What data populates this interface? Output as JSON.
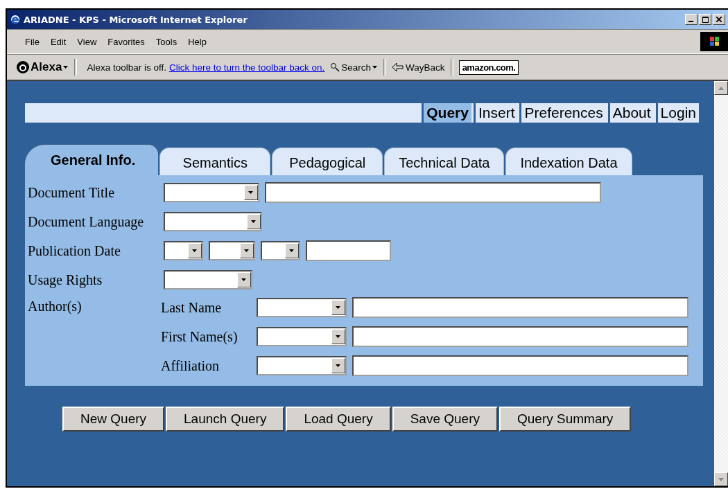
{
  "window": {
    "title": "ARIADNE - KPS - Microsoft Internet Explorer"
  },
  "menu": [
    {
      "label": "File"
    },
    {
      "label": "Edit"
    },
    {
      "label": "View"
    },
    {
      "label": "Favorites"
    },
    {
      "label": "Tools"
    },
    {
      "label": "Help"
    }
  ],
  "toolbar": {
    "alexa": "Alexa",
    "message": "Alexa toolbar is off.",
    "link": "Click here to turn the toolbar back on.",
    "search": "Search",
    "wayback": "WayBack",
    "amazon": "amazon.com."
  },
  "nav": [
    {
      "label": "Query",
      "selected": true
    },
    {
      "label": "Insert",
      "selected": false
    },
    {
      "label": "Preferences",
      "selected": false
    },
    {
      "label": "About",
      "selected": false
    },
    {
      "label": "Login",
      "selected": false
    }
  ],
  "tabs": [
    {
      "label": "General Info.",
      "selected": true
    },
    {
      "label": "Semantics",
      "selected": false
    },
    {
      "label": "Pedagogical",
      "selected": false
    },
    {
      "label": "Technical Data",
      "selected": false
    },
    {
      "label": "Indexation Data",
      "selected": false
    }
  ],
  "form": [
    {
      "label": "Document Title",
      "fields": [
        {
          "kind": "select"
        },
        {
          "kind": "text"
        }
      ]
    },
    {
      "label": "Document Language",
      "fields": [
        {
          "kind": "select"
        }
      ]
    },
    {
      "label": "Publication Date",
      "fields": [
        {
          "kind": "select"
        },
        {
          "kind": "select"
        },
        {
          "kind": "select"
        },
        {
          "kind": "text"
        }
      ]
    },
    {
      "label": "Usage Rights",
      "fields": [
        {
          "kind": "select"
        }
      ]
    }
  ],
  "authors": {
    "label": "Author(s)",
    "rows": [
      {
        "label": "Last Name",
        "fields": [
          {
            "kind": "select"
          },
          {
            "kind": "text"
          }
        ]
      },
      {
        "label": "First Name(s)",
        "fields": [
          {
            "kind": "select"
          },
          {
            "kind": "text"
          }
        ]
      },
      {
        "label": "Affiliation",
        "fields": [
          {
            "kind": "select"
          },
          {
            "kind": "text"
          }
        ]
      }
    ]
  },
  "buttons": [
    {
      "label": "New Query"
    },
    {
      "label": "Launch Query"
    },
    {
      "label": "Load Query"
    },
    {
      "label": "Save Query"
    },
    {
      "label": "Query Summary"
    }
  ]
}
